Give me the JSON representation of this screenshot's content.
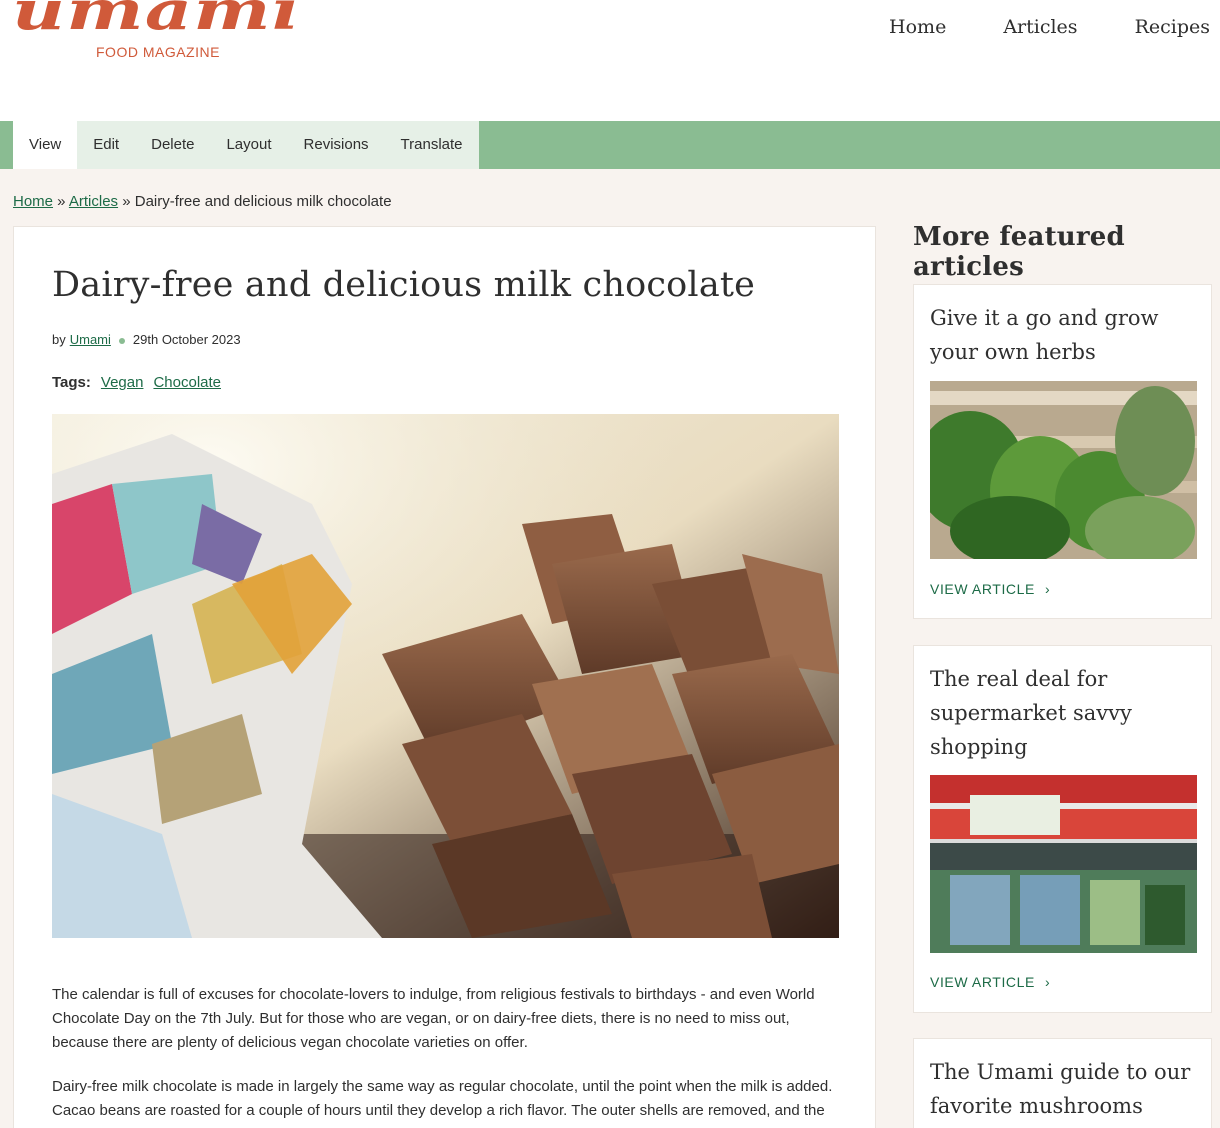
{
  "logo": {
    "word": "umami",
    "subtitle": "FOOD MAGAZINE"
  },
  "main_nav": [
    "Home",
    "Articles",
    "Recipes"
  ],
  "tabs": [
    {
      "label": "View",
      "active": true
    },
    {
      "label": "Edit",
      "active": false
    },
    {
      "label": "Delete",
      "active": false
    },
    {
      "label": "Layout",
      "active": false
    },
    {
      "label": "Revisions",
      "active": false
    },
    {
      "label": "Translate",
      "active": false
    }
  ],
  "breadcrumb": {
    "home": "Home",
    "sep1": " » ",
    "articles": "Articles",
    "sep2": " » ",
    "current": "Dairy-free and delicious milk chocolate"
  },
  "article": {
    "title": "Dairy-free and delicious milk chocolate",
    "by": "by",
    "author": "Umami",
    "date": "29th October 2023",
    "tags_label": "Tags:",
    "tags": [
      "Vegan",
      "Chocolate"
    ],
    "paragraphs": [
      "The calendar is full of excuses for chocolate-lovers to indulge, from religious festivals to birthdays - and even World Chocolate Day on the 7th July. But for those who are vegan, or on dairy-free diets, there is no need to miss out, because there are plenty of delicious vegan chocolate varieties on offer.",
      "Dairy-free milk chocolate is made in largely the same way as regular chocolate, until the point when the milk is added. Cacao beans are roasted for a couple of hours until they develop a rich flavor. The outer shells are removed, and the"
    ]
  },
  "sidebar": {
    "title": "More featured articles",
    "cards": [
      {
        "title": "Give it a go and grow your own herbs",
        "link": "VIEW ARTICLE"
      },
      {
        "title": "The real deal for supermarket savvy shopping",
        "link": "VIEW ARTICLE"
      },
      {
        "title": "The Umami guide to our favorite mushrooms",
        "link": ""
      }
    ]
  },
  "colors": {
    "brand": "#d05a3a",
    "tab_bar": "#8abc92",
    "link": "#1d6b47",
    "page_bg": "#f8f3ef"
  },
  "icons": [
    "chevron-right-icon"
  ]
}
